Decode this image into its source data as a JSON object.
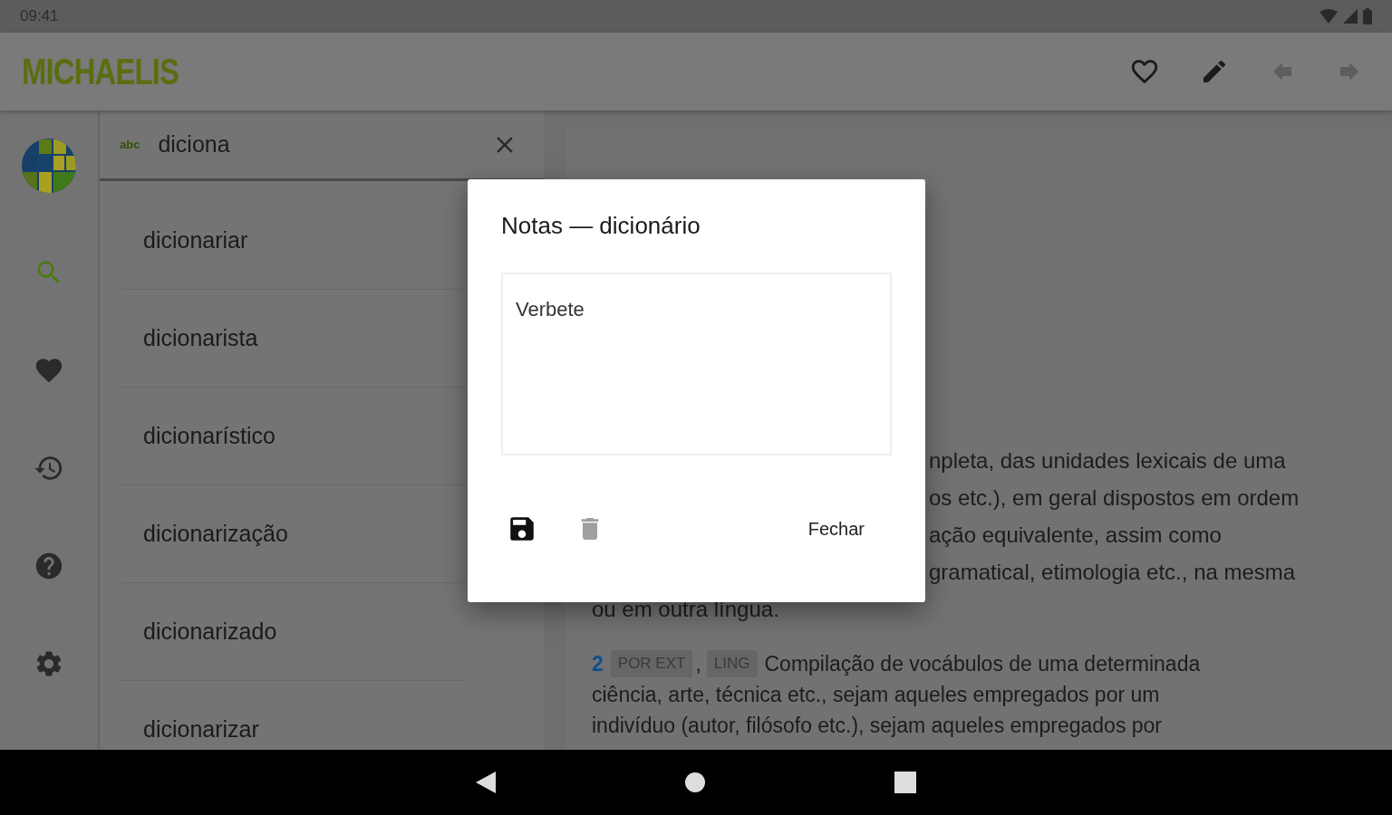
{
  "status_bar": {
    "time": "09:41"
  },
  "app_bar": {
    "logo": "MICHAELIS",
    "actions": [
      {
        "kind": "favorite",
        "disabled": false
      },
      {
        "kind": "edit",
        "disabled": false
      },
      {
        "kind": "back",
        "disabled": true
      },
      {
        "kind": "forward",
        "disabled": true
      }
    ]
  },
  "nav_rail": [
    {
      "kind": "search",
      "selected": true
    },
    {
      "kind": "favorites",
      "selected": false
    },
    {
      "kind": "history",
      "selected": false
    },
    {
      "kind": "help",
      "selected": false
    },
    {
      "kind": "settings",
      "selected": false
    }
  ],
  "search": {
    "mode_label": "abc",
    "value": "diciona"
  },
  "results": [
    "dicionariar",
    "dicionarista",
    "dicionarístico",
    "dicionarização",
    "dicionarizado",
    "dicionarizar"
  ],
  "entry": {
    "visible_lines": [
      "npleta, das unidades lexicais de uma",
      "os etc.), em geral dispostos em ordem",
      "ação equivalente, assim como",
      "gramatical, etimologia etc., na mesma"
    ],
    "last_line": "ou em outra língua.",
    "senses": [
      {
        "number": "2",
        "tags": [
          "POR EXT",
          "LING"
        ],
        "separator": ",",
        "text_lines": [
          "Compilação de vocábulos de uma determinada",
          "ciência, arte, técnica etc., sejam aqueles empregados por um",
          "indivíduo (autor, filósofo etc.), sejam aqueles empregados por"
        ]
      }
    ]
  },
  "dialog": {
    "title": "Notas — dicionário",
    "note": "Verbete",
    "actions": [
      {
        "kind": "save",
        "disabled": false
      },
      {
        "kind": "delete",
        "disabled": true
      }
    ],
    "close_label": "Fechar"
  }
}
